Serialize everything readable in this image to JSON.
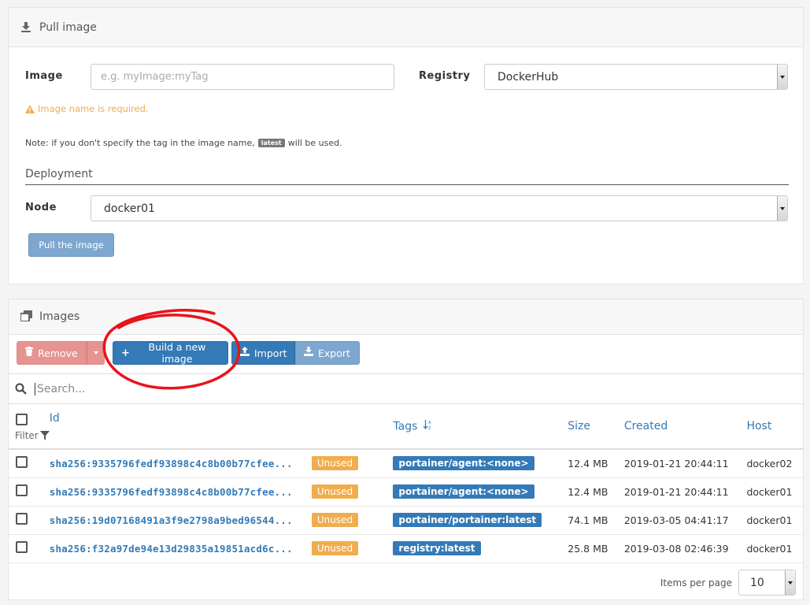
{
  "pull": {
    "title": "Pull image",
    "image_label": "Image",
    "image_placeholder": "e.g. myImage:myTag",
    "registry_label": "Registry",
    "registry_value": "DockerHub",
    "warning": "Image name is required.",
    "note_before": "Note: if you don't specify the tag in the image name,",
    "note_tag": "latest",
    "note_after": "will be used.",
    "deployment_title": "Deployment",
    "node_label": "Node",
    "node_value": "docker01",
    "pull_button": "Pull the image"
  },
  "images": {
    "title": "Images",
    "toolbar": {
      "remove": "Remove",
      "build": "Build a new image",
      "import": "Import",
      "export": "Export"
    },
    "search_placeholder": "Search...",
    "columns": {
      "id": "Id",
      "filter": "Filter",
      "tags": "Tags",
      "size": "Size",
      "created": "Created",
      "host": "Host"
    },
    "rows": [
      {
        "id": "sha256:9335796fedf93898c4c8b00b77cfee...",
        "status": "Unused",
        "tag": "portainer/agent:<none>",
        "size": "12.4 MB",
        "created": "2019-01-21 20:44:11",
        "host": "docker02"
      },
      {
        "id": "sha256:9335796fedf93898c4c8b00b77cfee...",
        "status": "Unused",
        "tag": "portainer/agent:<none>",
        "size": "12.4 MB",
        "created": "2019-01-21 20:44:11",
        "host": "docker01"
      },
      {
        "id": "sha256:19d07168491a3f9e2798a9bed96544...",
        "status": "Unused",
        "tag": "portainer/portainer:latest",
        "size": "74.1 MB",
        "created": "2019-03-05 04:41:17",
        "host": "docker01"
      },
      {
        "id": "sha256:f32a97de94e13d29835a19851acd6c...",
        "status": "Unused",
        "tag": "registry:latest",
        "size": "25.8 MB",
        "created": "2019-03-08 02:46:39",
        "host": "docker01"
      }
    ],
    "pagination": {
      "label": "Items per page",
      "value": "10"
    }
  },
  "colors": {
    "primary": "#337ab7",
    "warning": "#f0ad4e",
    "danger_muted": "#e59491",
    "annotation": "#e8141c"
  }
}
